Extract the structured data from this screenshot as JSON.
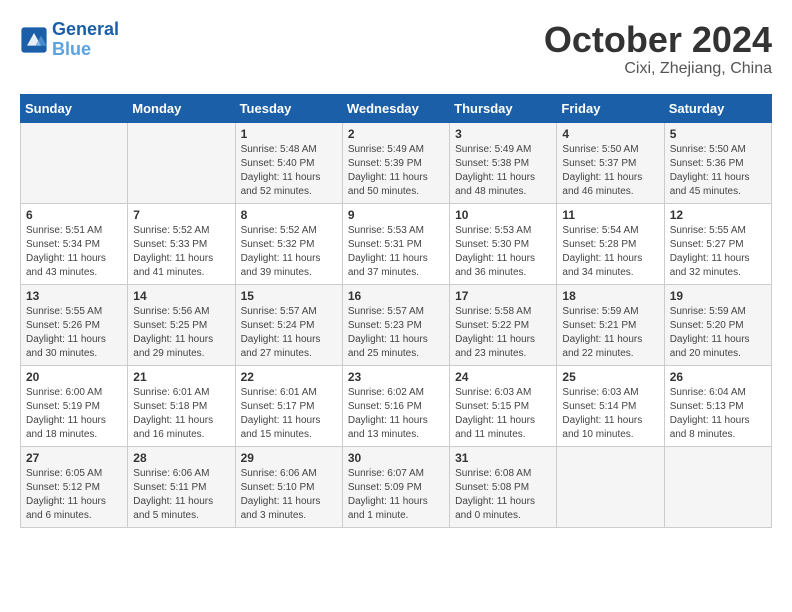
{
  "header": {
    "logo": {
      "line1": "General",
      "line2": "Blue"
    },
    "title": "October 2024",
    "location": "Cixi, Zhejiang, China"
  },
  "days_of_week": [
    "Sunday",
    "Monday",
    "Tuesday",
    "Wednesday",
    "Thursday",
    "Friday",
    "Saturday"
  ],
  "weeks": [
    [
      {
        "day": "",
        "content": ""
      },
      {
        "day": "",
        "content": ""
      },
      {
        "day": "1",
        "content": "Sunrise: 5:48 AM\nSunset: 5:40 PM\nDaylight: 11 hours and 52 minutes."
      },
      {
        "day": "2",
        "content": "Sunrise: 5:49 AM\nSunset: 5:39 PM\nDaylight: 11 hours and 50 minutes."
      },
      {
        "day": "3",
        "content": "Sunrise: 5:49 AM\nSunset: 5:38 PM\nDaylight: 11 hours and 48 minutes."
      },
      {
        "day": "4",
        "content": "Sunrise: 5:50 AM\nSunset: 5:37 PM\nDaylight: 11 hours and 46 minutes."
      },
      {
        "day": "5",
        "content": "Sunrise: 5:50 AM\nSunset: 5:36 PM\nDaylight: 11 hours and 45 minutes."
      }
    ],
    [
      {
        "day": "6",
        "content": "Sunrise: 5:51 AM\nSunset: 5:34 PM\nDaylight: 11 hours and 43 minutes."
      },
      {
        "day": "7",
        "content": "Sunrise: 5:52 AM\nSunset: 5:33 PM\nDaylight: 11 hours and 41 minutes."
      },
      {
        "day": "8",
        "content": "Sunrise: 5:52 AM\nSunset: 5:32 PM\nDaylight: 11 hours and 39 minutes."
      },
      {
        "day": "9",
        "content": "Sunrise: 5:53 AM\nSunset: 5:31 PM\nDaylight: 11 hours and 37 minutes."
      },
      {
        "day": "10",
        "content": "Sunrise: 5:53 AM\nSunset: 5:30 PM\nDaylight: 11 hours and 36 minutes."
      },
      {
        "day": "11",
        "content": "Sunrise: 5:54 AM\nSunset: 5:28 PM\nDaylight: 11 hours and 34 minutes."
      },
      {
        "day": "12",
        "content": "Sunrise: 5:55 AM\nSunset: 5:27 PM\nDaylight: 11 hours and 32 minutes."
      }
    ],
    [
      {
        "day": "13",
        "content": "Sunrise: 5:55 AM\nSunset: 5:26 PM\nDaylight: 11 hours and 30 minutes."
      },
      {
        "day": "14",
        "content": "Sunrise: 5:56 AM\nSunset: 5:25 PM\nDaylight: 11 hours and 29 minutes."
      },
      {
        "day": "15",
        "content": "Sunrise: 5:57 AM\nSunset: 5:24 PM\nDaylight: 11 hours and 27 minutes."
      },
      {
        "day": "16",
        "content": "Sunrise: 5:57 AM\nSunset: 5:23 PM\nDaylight: 11 hours and 25 minutes."
      },
      {
        "day": "17",
        "content": "Sunrise: 5:58 AM\nSunset: 5:22 PM\nDaylight: 11 hours and 23 minutes."
      },
      {
        "day": "18",
        "content": "Sunrise: 5:59 AM\nSunset: 5:21 PM\nDaylight: 11 hours and 22 minutes."
      },
      {
        "day": "19",
        "content": "Sunrise: 5:59 AM\nSunset: 5:20 PM\nDaylight: 11 hours and 20 minutes."
      }
    ],
    [
      {
        "day": "20",
        "content": "Sunrise: 6:00 AM\nSunset: 5:19 PM\nDaylight: 11 hours and 18 minutes."
      },
      {
        "day": "21",
        "content": "Sunrise: 6:01 AM\nSunset: 5:18 PM\nDaylight: 11 hours and 16 minutes."
      },
      {
        "day": "22",
        "content": "Sunrise: 6:01 AM\nSunset: 5:17 PM\nDaylight: 11 hours and 15 minutes."
      },
      {
        "day": "23",
        "content": "Sunrise: 6:02 AM\nSunset: 5:16 PM\nDaylight: 11 hours and 13 minutes."
      },
      {
        "day": "24",
        "content": "Sunrise: 6:03 AM\nSunset: 5:15 PM\nDaylight: 11 hours and 11 minutes."
      },
      {
        "day": "25",
        "content": "Sunrise: 6:03 AM\nSunset: 5:14 PM\nDaylight: 11 hours and 10 minutes."
      },
      {
        "day": "26",
        "content": "Sunrise: 6:04 AM\nSunset: 5:13 PM\nDaylight: 11 hours and 8 minutes."
      }
    ],
    [
      {
        "day": "27",
        "content": "Sunrise: 6:05 AM\nSunset: 5:12 PM\nDaylight: 11 hours and 6 minutes."
      },
      {
        "day": "28",
        "content": "Sunrise: 6:06 AM\nSunset: 5:11 PM\nDaylight: 11 hours and 5 minutes."
      },
      {
        "day": "29",
        "content": "Sunrise: 6:06 AM\nSunset: 5:10 PM\nDaylight: 11 hours and 3 minutes."
      },
      {
        "day": "30",
        "content": "Sunrise: 6:07 AM\nSunset: 5:09 PM\nDaylight: 11 hours and 1 minute."
      },
      {
        "day": "31",
        "content": "Sunrise: 6:08 AM\nSunset: 5:08 PM\nDaylight: 11 hours and 0 minutes."
      },
      {
        "day": "",
        "content": ""
      },
      {
        "day": "",
        "content": ""
      }
    ]
  ]
}
